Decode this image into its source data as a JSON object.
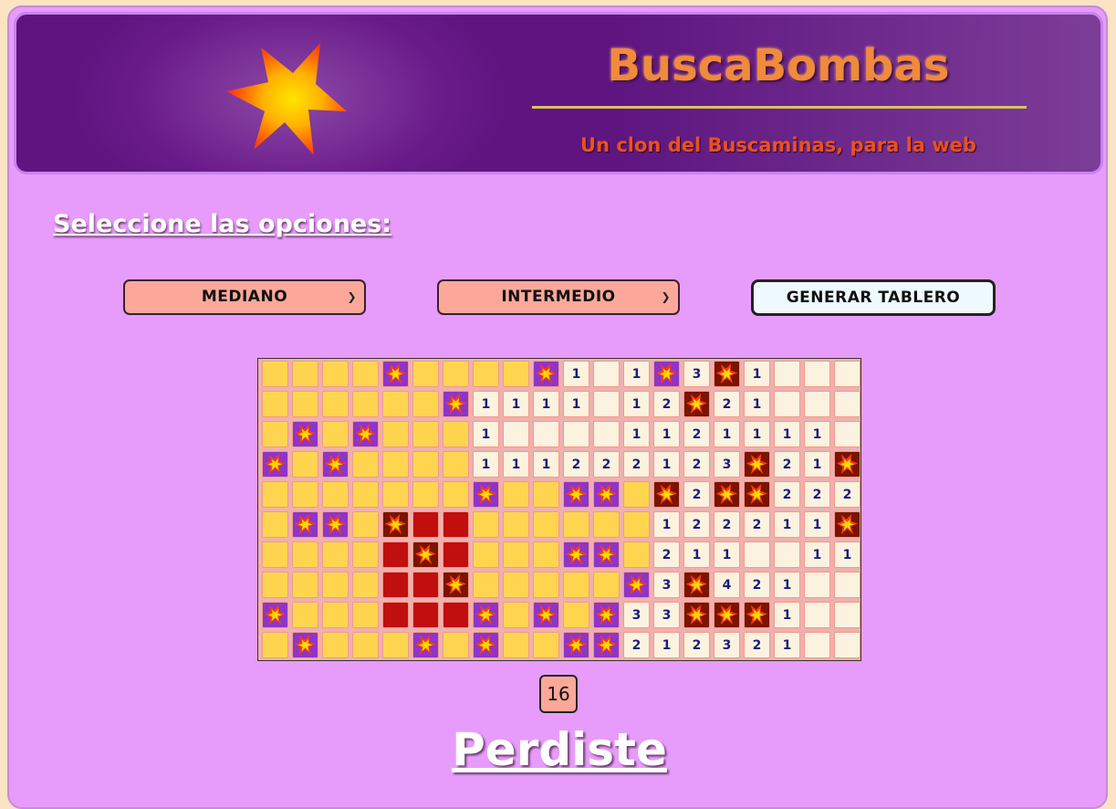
{
  "header": {
    "title": "BuscaBombas",
    "subtitle": "Un clon del Buscaminas, para la web",
    "logo_icon": "explosion-star-icon"
  },
  "options": {
    "title": "Seleccione las opciones:",
    "size_select": "MEDIANO",
    "difficulty_select": "INTERMEDIO",
    "generate_button": "GENERAR TABLERO"
  },
  "board": {
    "cols": 20,
    "rows": 10,
    "legend": {
      "H": "hidden",
      "O": "open",
      "B": "bomb-hidden",
      "X": "bomb-exploded",
      "R": "red-hidden"
    },
    "grid": [
      [
        "H",
        "H",
        "H",
        "H",
        "B",
        "H",
        "H",
        "H",
        "H",
        "B",
        "1",
        "O",
        "1",
        "B",
        "3",
        "X",
        "1",
        "O",
        "O",
        "O"
      ],
      [
        "H",
        "H",
        "H",
        "H",
        "H",
        "H",
        "B",
        "1",
        "1",
        "1",
        "1",
        "O",
        "1",
        "2",
        "X",
        "2",
        "1",
        "O",
        "O",
        "O"
      ],
      [
        "H",
        "B",
        "H",
        "B",
        "H",
        "H",
        "H",
        "1",
        "O",
        "O",
        "O",
        "O",
        "1",
        "1",
        "2",
        "1",
        "1",
        "1",
        "1",
        "O"
      ],
      [
        "B",
        "H",
        "B",
        "H",
        "H",
        "H",
        "H",
        "1",
        "1",
        "1",
        "2",
        "2",
        "2",
        "1",
        "2",
        "3",
        "X",
        "2",
        "1",
        "X"
      ],
      [
        "H",
        "H",
        "H",
        "H",
        "H",
        "H",
        "H",
        "B",
        "H",
        "H",
        "B",
        "B",
        "H",
        "X",
        "2",
        "X",
        "X",
        "2",
        "2",
        "2"
      ],
      [
        "H",
        "B",
        "B",
        "H",
        "X",
        "R",
        "R",
        "H",
        "H",
        "H",
        "H",
        "H",
        "H",
        "1",
        "2",
        "2",
        "2",
        "1",
        "1",
        "X"
      ],
      [
        "H",
        "H",
        "H",
        "H",
        "R",
        "X",
        "R",
        "H",
        "H",
        "H",
        "B",
        "B",
        "H",
        "2",
        "1",
        "1",
        "O",
        "O",
        "1",
        "1"
      ],
      [
        "H",
        "H",
        "H",
        "H",
        "R",
        "R",
        "X",
        "H",
        "H",
        "H",
        "H",
        "H",
        "B",
        "3",
        "X",
        "4",
        "2",
        "1",
        "O",
        "O"
      ],
      [
        "B",
        "H",
        "H",
        "H",
        "R",
        "R",
        "R",
        "B",
        "H",
        "B",
        "H",
        "B",
        "3",
        "3",
        "X",
        "X",
        "X",
        "1",
        "O",
        "O"
      ],
      [
        "H",
        "B",
        "H",
        "H",
        "H",
        "B",
        "H",
        "B",
        "H",
        "H",
        "B",
        "B",
        "2",
        "1",
        "2",
        "3",
        "2",
        "1",
        "O",
        "O"
      ]
    ]
  },
  "status": {
    "counter": "16",
    "result": "Perdiste"
  }
}
